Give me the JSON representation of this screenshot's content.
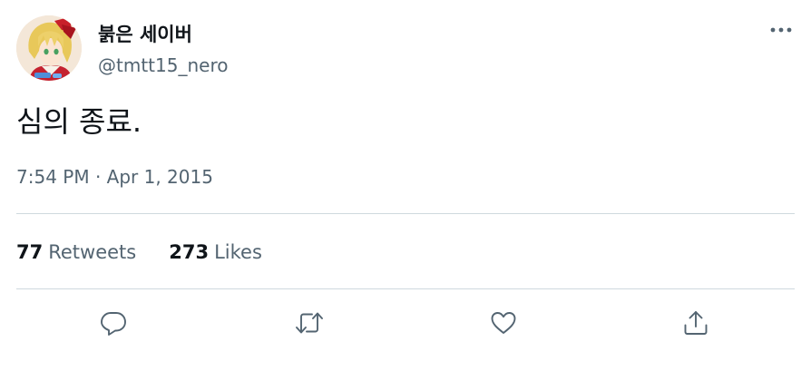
{
  "author": {
    "display_name": "붉은 세이버",
    "handle": "@tmtt15_nero",
    "avatar_icon": "anime-character-avatar"
  },
  "tweet": {
    "text": "심의 종료.",
    "timestamp": "7:54 PM · Apr 1, 2015"
  },
  "stats": {
    "retweets_count": "77",
    "retweets_label": "Retweets",
    "likes_count": "273",
    "likes_label": "Likes"
  },
  "actions": {
    "reply_icon": "speech-bubble-icon",
    "retweet_icon": "retweet-arrows-icon",
    "like_icon": "heart-icon",
    "share_icon": "share-upload-icon",
    "more_icon": "three-dots-icon"
  },
  "colors": {
    "primary_text": "#0f1419",
    "secondary_text": "#536471",
    "divider": "#cfd9de",
    "background": "#ffffff"
  }
}
